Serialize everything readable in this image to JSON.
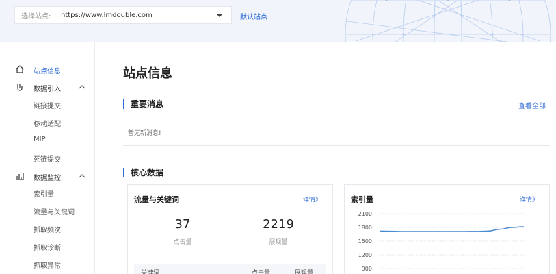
{
  "header": {
    "site_label": "选择站点:",
    "site_value": "https://www.lmdouble.com",
    "default_site": "默认站点"
  },
  "sidebar": {
    "groups": [
      {
        "label": "站点信息",
        "icon": "home-icon",
        "active": true
      },
      {
        "label": "数据引入",
        "icon": "data-import-icon",
        "expanded": true,
        "items": [
          "链接提交",
          "移动适配",
          "MIP",
          "死链提交"
        ]
      },
      {
        "label": "数据监控",
        "icon": "monitor-chart-icon",
        "expanded": true,
        "items": [
          "索引量",
          "流量与关键词",
          "抓取频次",
          "抓取诊断",
          "抓取异常"
        ]
      }
    ]
  },
  "main": {
    "title": "站点信息",
    "messages": {
      "title": "重要消息",
      "view_all": "查看全部",
      "empty": "暂无新消息!"
    },
    "core": {
      "title": "核心数据",
      "traffic": {
        "title": "流量与关键词",
        "details": "详情》",
        "clicks": {
          "value": "37",
          "label": "点击量"
        },
        "impressions": {
          "value": "2219",
          "label": "展现量"
        },
        "table_headers": [
          "关键词",
          "点击量",
          "展现量"
        ]
      },
      "index": {
        "title": "索引量",
        "details": "详情》"
      }
    }
  },
  "colors": {
    "accent": "#2d6ad6",
    "line": "#4a8ad0",
    "header_bg": "#f1f4fa"
  },
  "chart_data": {
    "type": "line",
    "title": "索引量",
    "ylim": [
      900,
      2100
    ],
    "yticks": [
      2100,
      1800,
      1500,
      1200,
      900
    ],
    "grid": true,
    "series": [
      {
        "values": [
          1720,
          1715,
          1710,
          1710,
          1710,
          1710,
          1710,
          1710,
          1712,
          1720,
          1760,
          1800,
          1815
        ]
      }
    ]
  }
}
